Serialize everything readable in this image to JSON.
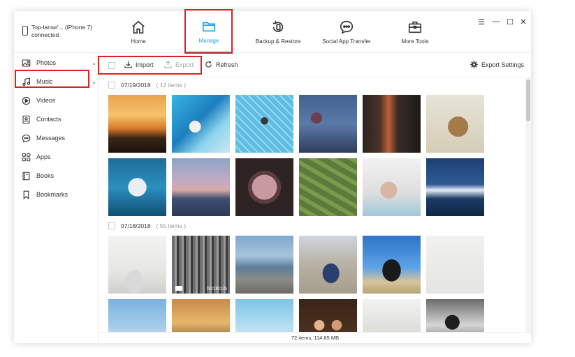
{
  "device": {
    "name": "Top-lanse'... (iPhone 7)",
    "status": "connected"
  },
  "nav": [
    {
      "label": "Home",
      "icon": "home-icon"
    },
    {
      "label": "Manage",
      "icon": "folder-icon",
      "active": true
    },
    {
      "label": "Backup & Restore",
      "icon": "backup-restore-icon"
    },
    {
      "label": "Social App Transfer",
      "icon": "chat-bubble-icon"
    },
    {
      "label": "More Tools",
      "icon": "toolbox-icon"
    }
  ],
  "window_controls": [
    "☰",
    "—",
    "☐",
    "✕"
  ],
  "sidebar": [
    {
      "label": "Photos",
      "icon": "photo-icon",
      "chevron": "⌄"
    },
    {
      "label": "Music",
      "icon": "music-note-icon",
      "chevron": "⌄"
    },
    {
      "label": "Videos",
      "icon": "play-circle-icon"
    },
    {
      "label": "Contacts",
      "icon": "contact-card-icon"
    },
    {
      "label": "Messages",
      "icon": "message-bubble-icon"
    },
    {
      "label": "Apps",
      "icon": "apps-grid-icon"
    },
    {
      "label": "Books",
      "icon": "book-icon"
    },
    {
      "label": "Bookmarks",
      "icon": "bookmark-icon"
    }
  ],
  "toolbar": {
    "import_label": "Import",
    "export_label": "Export",
    "refresh_label": "Refresh",
    "export_settings_label": "Export Settings"
  },
  "groups": [
    {
      "date": "07/19/2018",
      "count": "( 12 items )"
    },
    {
      "date": "07/18/2018",
      "count": "( 55 items )"
    }
  ],
  "video_duration": "00:00:05",
  "status": "72 items, 114.65 MB",
  "colors": {
    "accent": "#1ba3e8",
    "highlight": "#e02020"
  }
}
